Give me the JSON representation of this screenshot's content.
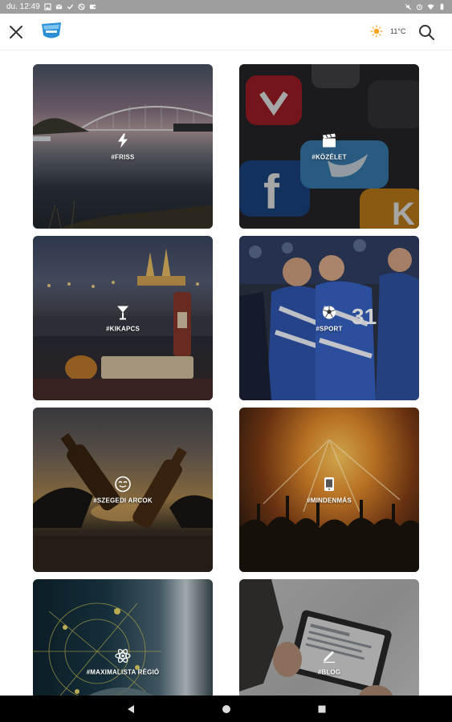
{
  "status_bar": {
    "time": "du. 12:49"
  },
  "header": {
    "temperature": "11°C"
  },
  "categories": [
    {
      "label": "#FRISS",
      "icon": "lightning-icon"
    },
    {
      "label": "#KÖZÉLET",
      "icon": "clapperboard-icon"
    },
    {
      "label": "#KIKAPCS",
      "icon": "cocktail-icon"
    },
    {
      "label": "#SPORT",
      "icon": "soccer-ball-icon"
    },
    {
      "label": "#SZEGEDI ARCOK",
      "icon": "face-icon"
    },
    {
      "label": "#MINDENMÁS",
      "icon": "phone-icon"
    },
    {
      "label": "#MAXIMALISTA RÉGIÓ",
      "icon": "atom-icon"
    },
    {
      "label": "#BLOG",
      "icon": "pen-icon"
    }
  ]
}
